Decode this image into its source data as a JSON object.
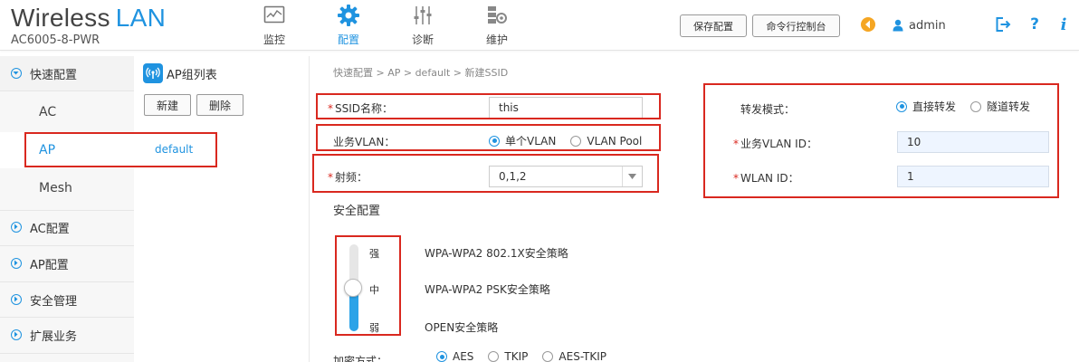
{
  "brand": {
    "title_main": "Wireless",
    "title_accent": "LAN",
    "model": "AC6005-8-PWR"
  },
  "nav": [
    {
      "label": "监控",
      "icon": "monitor-icon"
    },
    {
      "label": "配置",
      "icon": "gear-icon",
      "active": true
    },
    {
      "label": "诊断",
      "icon": "sliders-icon"
    },
    {
      "label": "维护",
      "icon": "maintenance-icon"
    }
  ],
  "header": {
    "save_label": "保存配置",
    "console_label": "命令行控制台",
    "user": "admin",
    "help": "?",
    "info": "i"
  },
  "sidebar": {
    "quick_config": "快速配置",
    "sub_items": [
      "AC",
      "AP",
      "Mesh"
    ],
    "ac_config": "AC配置",
    "ap_config": "AP配置",
    "security": "安全管理",
    "extension": "扩展业务"
  },
  "apgroup": {
    "title": "AP组列表",
    "new_label": "新建",
    "delete_label": "删除",
    "items": [
      "default"
    ]
  },
  "breadcrumb": "快速配置 > AP > default > 新建SSID",
  "form": {
    "ssid_label": "SSID名称：",
    "ssid_value": "this",
    "vlan_label": "业务VLAN：",
    "vlan_opt1": "单个VLAN",
    "vlan_opt2": "VLAN Pool",
    "radio_label": "射频：",
    "radio_value": "0,1,2",
    "forward_label": "转发模式：",
    "forward_opt1": "直接转发",
    "forward_opt2": "隧道转发",
    "vlan_id_label": "业务VLAN ID：",
    "vlan_id_value": "10",
    "wlan_id_label": "WLAN ID：",
    "wlan_id_value": "1"
  },
  "security": {
    "title": "安全配置",
    "levels": [
      "强",
      "中",
      "弱"
    ],
    "policies": [
      "WPA-WPA2 802.1X安全策略",
      "WPA-WPA2 PSK安全策略",
      "OPEN安全策略"
    ],
    "selected_level": "中",
    "encrypt_label": "加密方式：",
    "encrypt_opts": [
      "AES",
      "TKIP",
      "AES-TKIP"
    ]
  },
  "colors": {
    "accent": "#1f93e0",
    "highlight": "#d9281f"
  }
}
